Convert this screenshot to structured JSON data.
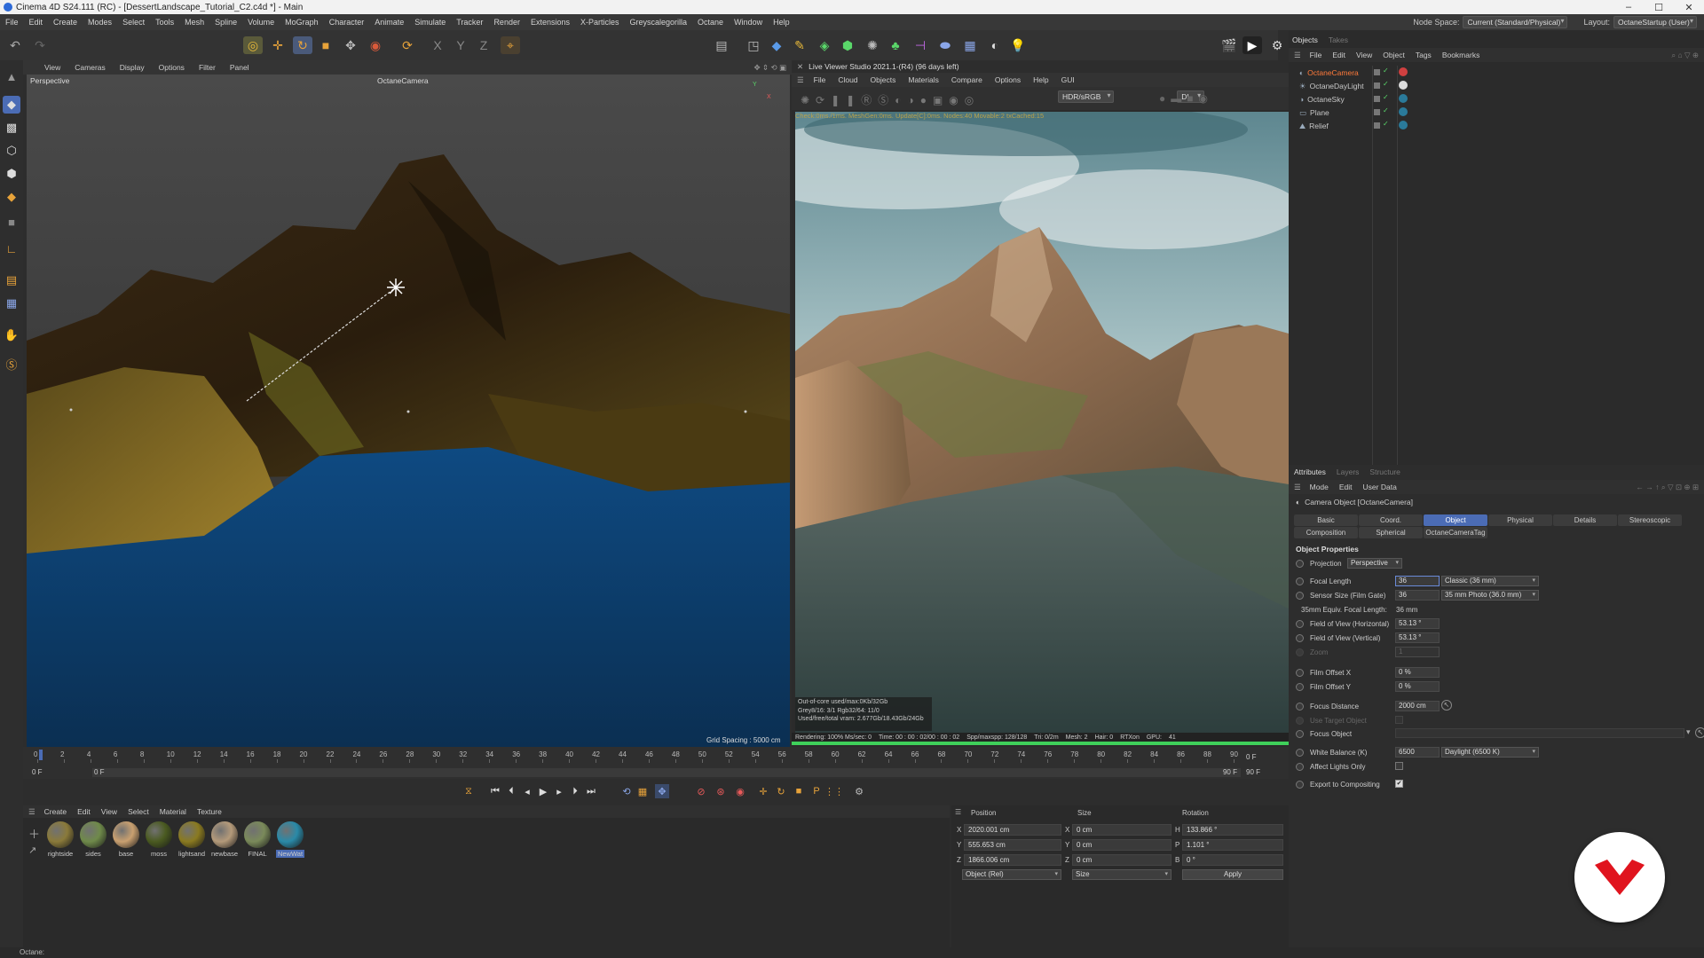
{
  "app": {
    "window_title": "Cinema 4D S24.111 (RC) - [DessertLandscape_Tutorial_C2.c4d *] - Main",
    "win_min": "–",
    "win_max": "☐",
    "win_close": "✕"
  },
  "menubar": {
    "items": [
      "File",
      "Edit",
      "Create",
      "Modes",
      "Select",
      "Tools",
      "Mesh",
      "Spline",
      "Volume",
      "MoGraph",
      "Character",
      "Animate",
      "Simulate",
      "Tracker",
      "Render",
      "Extensions",
      "X-Particles",
      "Greyscalegorilla",
      "Octane",
      "Window",
      "Help"
    ],
    "node_space_label": "Node Space:",
    "node_space_value": "Current (Standard/Physical)",
    "layout_label": "Layout:",
    "layout_value": "OctaneStartup (User)"
  },
  "viewport": {
    "menu": [
      "View",
      "Cameras",
      "Display",
      "Options",
      "Filter",
      "Panel"
    ],
    "name": "Perspective",
    "camera": "OctaneCamera",
    "grid_spacing": "Grid Spacing : 5000 cm"
  },
  "live_viewer": {
    "title": "Live Viewer Studio 2021.1-(R4) (96 days left)",
    "menu": [
      "File",
      "Cloud",
      "Objects",
      "Materials",
      "Compare",
      "Options",
      "Help",
      "GUI"
    ],
    "colorspace": "HDR/sRGB",
    "mode": "DL",
    "status": "Check:0ms./1ms. MeshGen:0ms. Update[C]:0ms. Nodes:40 Movable:2 txCached:15",
    "info": [
      "Out-of-core used/max:0Kb/32Gb",
      "Grey8/16: 3/1          Rgb32/64: 11/0",
      "Used/free/total vram: 2.677Gb/18.43Gb/24Gb"
    ],
    "bar_items": [
      "Rendering: 100% Ms/sec: 0",
      "Time: 00 : 00 : 02/00 : 00 : 02",
      "Spp/maxspp: 128/128",
      "Tri: 0/2m",
      "Mesh: 2",
      "Hair: 0",
      "RTXon",
      "GPU:",
      "41"
    ],
    "progress": 100
  },
  "timeline": {
    "ticks": [
      "0",
      "2",
      "4",
      "6",
      "8",
      "10",
      "12",
      "14",
      "16",
      "18",
      "20",
      "22",
      "24",
      "26",
      "28",
      "30",
      "32",
      "34",
      "36",
      "38",
      "40",
      "42",
      "44",
      "46",
      "48",
      "50",
      "52",
      "54",
      "56",
      "58",
      "60",
      "62",
      "64",
      "66",
      "68",
      "70",
      "72",
      "74",
      "76",
      "78",
      "80",
      "82",
      "84",
      "86",
      "88",
      "90"
    ],
    "current": "0 F",
    "start": "0 F",
    "start2": "0 F",
    "end": "90 F",
    "end2": "90 F"
  },
  "materials": {
    "menu": [
      "Create",
      "Edit",
      "View",
      "Select",
      "Material",
      "Texture"
    ],
    "items": [
      {
        "name": "rightside",
        "color": "#8a7a3a"
      },
      {
        "name": "sides",
        "color": "#6f8a4a"
      },
      {
        "name": "base",
        "color": "#c9a070"
      },
      {
        "name": "moss",
        "color": "#4a5a20"
      },
      {
        "name": "lightsand",
        "color": "#8a7a20"
      },
      {
        "name": "newbase",
        "color": "#b49a7a"
      },
      {
        "name": "FINAL",
        "color": "#7a8a5a"
      },
      {
        "name": "NewWat",
        "color": "#2a8aa8"
      }
    ]
  },
  "coords": {
    "headers": [
      "Position",
      "Size",
      "Rotation"
    ],
    "rows": [
      {
        "axis": "X",
        "pos": "2020.001 cm",
        "size_axis": "X",
        "size": "0 cm",
        "rot_axis": "H",
        "rot": "133.866 °"
      },
      {
        "axis": "Y",
        "pos": "555.653 cm",
        "size_axis": "Y",
        "size": "0 cm",
        "rot_axis": "P",
        "rot": "1.101 °"
      },
      {
        "axis": "Z",
        "pos": "1866.006 cm",
        "size_axis": "Z",
        "size": "0 cm",
        "rot_axis": "B",
        "rot": "0 °"
      }
    ],
    "mode": "Object (Rel)",
    "size_mode": "Size",
    "apply": "Apply"
  },
  "objects": {
    "tabs": [
      "Objects",
      "Takes"
    ],
    "menu": [
      "File",
      "Edit",
      "View",
      "Object",
      "Tags",
      "Bookmarks"
    ],
    "items": [
      {
        "name": "OctaneCamera",
        "color": "#ff7a3a"
      },
      {
        "name": "OctaneDayLight",
        "color": "#c8c8c8"
      },
      {
        "name": "OctaneSky",
        "color": "#c8c8c8"
      },
      {
        "name": "Plane",
        "color": "#c8c8c8"
      },
      {
        "name": "Relief",
        "color": "#c8c8c8"
      }
    ]
  },
  "attributes": {
    "tabs": [
      "Attributes",
      "Layers",
      "Structure"
    ],
    "menu": [
      "Mode",
      "Edit",
      "User Data"
    ],
    "object_label": "Camera Object [OctaneCamera]",
    "prop_tabs_row1": [
      "Basic",
      "Coord.",
      "Object",
      "Physical",
      "Details",
      "Stereoscopic"
    ],
    "prop_tabs_row2": [
      "Composition",
      "Spherical",
      "OctaneCameraTag"
    ],
    "section": "Object Properties",
    "projection_label": "Projection",
    "projection_value": "Perspective",
    "focal_length_label": "Focal Length",
    "focal_length_value": "36",
    "focal_preset": "Classic (36 mm)",
    "sensor_label": "Sensor Size (Film Gate)",
    "sensor_value": "36",
    "sensor_preset": "35 mm Photo (36.0 mm)",
    "equiv_label": "35mm Equiv. Focal Length:",
    "equiv_value": "36 mm",
    "fov_h_label": "Field of View (Horizontal)",
    "fov_h_value": "53.13 °",
    "fov_v_label": "Field of View (Vertical)",
    "fov_v_value": "53.13 °",
    "zoom_label": "Zoom",
    "zoom_value": "1",
    "film_x_label": "Film Offset X",
    "film_x_value": "0 %",
    "film_y_label": "Film Offset Y",
    "film_y_value": "0 %",
    "focus_dist_label": "Focus Distance",
    "focus_dist_value": "2000 cm",
    "use_target_label": "Use Target Object",
    "focus_obj_label": "Focus Object",
    "wb_label": "White Balance (K)",
    "wb_value": "6500",
    "wb_preset": "Daylight (6500 K)",
    "affect_label": "Affect Lights Only",
    "export_label": "Export to Compositing",
    "export_checked": "✔"
  },
  "statusbar": {
    "text": "Octane:"
  },
  "colors": {
    "accent": "#4b6cb5",
    "brand_red": "#e0141e",
    "progress": "#3fd05a"
  }
}
